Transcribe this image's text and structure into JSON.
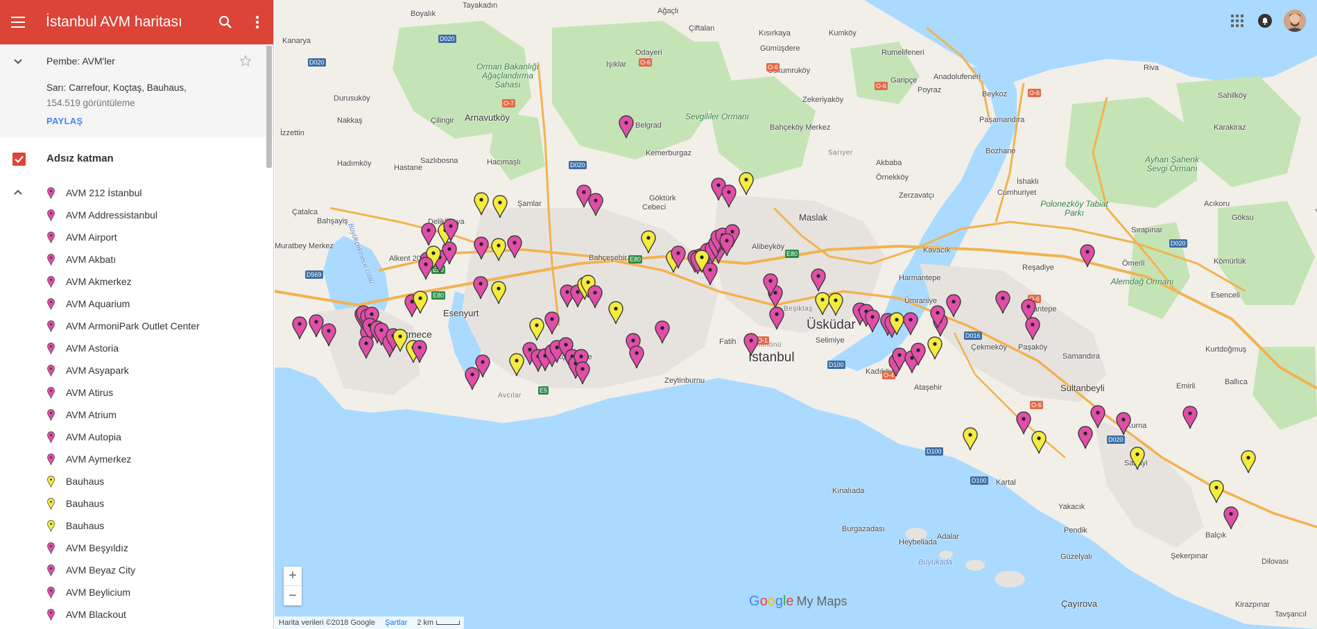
{
  "header": {
    "title": "İstanbul AVM haritası",
    "menu_icon": "menu-icon",
    "search_icon": "search-icon",
    "more_icon": "more-vert-icon",
    "color": "#db4437"
  },
  "info": {
    "layer_title": "Pembe: AVM'ler",
    "description": "Sarı: Carrefour, Koçtaş, Bauhaus,",
    "views": "154.519 görüntüleme",
    "share_label": "PAYLAŞ"
  },
  "layer": {
    "name": "Adsız katman",
    "checked": true
  },
  "features": [
    {
      "name": "AVM 212 İstanbul",
      "color": "pink"
    },
    {
      "name": "AVM Addressistanbul",
      "color": "pink"
    },
    {
      "name": "AVM Airport",
      "color": "pink"
    },
    {
      "name": "AVM Akbatı",
      "color": "pink"
    },
    {
      "name": "AVM Akmerkez",
      "color": "pink"
    },
    {
      "name": "AVM Aquarium",
      "color": "pink"
    },
    {
      "name": "AVM ArmoniPark Outlet Center",
      "color": "pink"
    },
    {
      "name": "AVM Astoria",
      "color": "pink"
    },
    {
      "name": "AVM Asyapark",
      "color": "pink"
    },
    {
      "name": "AVM Atirus",
      "color": "pink"
    },
    {
      "name": "AVM Atrium",
      "color": "pink"
    },
    {
      "name": "AVM Autopia",
      "color": "pink"
    },
    {
      "name": "AVM Aymerkez",
      "color": "pink"
    },
    {
      "name": "Bauhaus",
      "color": "yellow"
    },
    {
      "name": "Bauhaus",
      "color": "yellow"
    },
    {
      "name": "Bauhaus",
      "color": "yellow"
    },
    {
      "name": "AVM Beşyıldız",
      "color": "pink"
    },
    {
      "name": "AVM Beyaz City",
      "color": "pink"
    },
    {
      "name": "AVM Beylicium",
      "color": "pink"
    },
    {
      "name": "AVM Blackout",
      "color": "pink"
    }
  ],
  "colors": {
    "pink": "#e04ea8",
    "yellow": "#f4eb3f",
    "water": "#aadaff",
    "land": "#f2efe9",
    "park": "#c5e4b6",
    "urban": "#e6e3df"
  },
  "map": {
    "places": [
      {
        "name": "İstanbul",
        "class": "big"
      },
      {
        "name": "Üsküdar",
        "class": "big"
      },
      {
        "name": "Büyükçekmece",
        "class": "big-sm"
      },
      {
        "name": "Esenyurt",
        "class": "mid"
      },
      {
        "name": "Arnavutköy",
        "class": "mid"
      },
      {
        "name": "Maslak",
        "class": "mid"
      },
      {
        "name": "Kadıköy",
        "class": ""
      },
      {
        "name": "Ataşehir",
        "class": ""
      },
      {
        "name": "Sultanbeyli",
        "class": "mid"
      },
      {
        "name": "Samandıra",
        "class": ""
      },
      {
        "name": "Pendik",
        "class": ""
      },
      {
        "name": "Kartal",
        "class": ""
      },
      {
        "name": "Ümraniye",
        "class": ""
      },
      {
        "name": "Beykoz",
        "class": ""
      },
      {
        "name": "Zeytinburnu",
        "class": ""
      },
      {
        "name": "Fatih",
        "class": ""
      },
      {
        "name": "Küçükçekmece",
        "class": ""
      },
      {
        "name": "Avcılar",
        "class": "district"
      },
      {
        "name": "Bahçeşehir",
        "class": ""
      },
      {
        "name": "Sarıyer",
        "class": "district"
      },
      {
        "name": "Beşiktaş",
        "class": "district"
      },
      {
        "name": "Eminönü",
        "class": "district"
      },
      {
        "name": "Alibeyköy",
        "class": ""
      },
      {
        "name": "Çekmeköy",
        "class": ""
      },
      {
        "name": "Ömerli",
        "class": ""
      },
      {
        "name": "Kurna",
        "class": ""
      },
      {
        "name": "Sanayi",
        "class": ""
      },
      {
        "name": "Güzelyalı",
        "class": ""
      },
      {
        "name": "Çayırova",
        "class": "mid"
      },
      {
        "name": "Kınalıada",
        "class": ""
      },
      {
        "name": "Burgazadası",
        "class": ""
      },
      {
        "name": "Büyükada",
        "class": "water"
      },
      {
        "name": "Heybeliada",
        "class": ""
      },
      {
        "name": "Yakacık",
        "class": ""
      },
      {
        "name": "Kemerburgaz",
        "class": ""
      },
      {
        "name": "Göktürk",
        "class": ""
      },
      {
        "name": "Çatalca",
        "class": ""
      },
      {
        "name": "Hadımköy",
        "class": ""
      },
      {
        "name": "Hastane",
        "class": ""
      },
      {
        "name": "Sazlıbosna",
        "class": ""
      },
      {
        "name": "Deliklikaya",
        "class": ""
      },
      {
        "name": "Alkent 2000",
        "class": ""
      },
      {
        "name": "Bahşayiş",
        "class": ""
      },
      {
        "name": "Muratbey Merkez",
        "class": ""
      },
      {
        "name": "Boyalık",
        "class": ""
      },
      {
        "name": "Tayakadın",
        "class": ""
      },
      {
        "name": "Ağaçlı",
        "class": ""
      },
      {
        "name": "Çiftalan",
        "class": ""
      },
      {
        "name": "Kısırkaya",
        "class": ""
      },
      {
        "name": "Kumköy",
        "class": ""
      },
      {
        "name": "Rumelifeneri",
        "class": ""
      },
      {
        "name": "Gümüşdere",
        "class": ""
      },
      {
        "name": "Uskumruköy",
        "class": ""
      },
      {
        "name": "Zekeriyaköy",
        "class": ""
      },
      {
        "name": "Garipçe",
        "class": ""
      },
      {
        "name": "Poyraz",
        "class": ""
      },
      {
        "name": "Anadolufeneri",
        "class": ""
      },
      {
        "name": "Paşamandıra",
        "class": ""
      },
      {
        "name": "Riva",
        "class": ""
      },
      {
        "name": "Sahilköy",
        "class": ""
      },
      {
        "name": "Karakiraz",
        "class": ""
      },
      {
        "name": "Bozhane",
        "class": ""
      },
      {
        "name": "Akbaba",
        "class": ""
      },
      {
        "name": "Örnekköy",
        "class": ""
      },
      {
        "name": "Zerzavatçı",
        "class": ""
      },
      {
        "name": "Cumhuriyet",
        "class": ""
      },
      {
        "name": "İshaklı",
        "class": ""
      },
      {
        "name": "Acıkoru",
        "class": ""
      },
      {
        "name": "Göksu",
        "class": ""
      },
      {
        "name": "Yeniköy",
        "class": ""
      },
      {
        "name": "Sırapınar",
        "class": ""
      },
      {
        "name": "Reşadiye",
        "class": ""
      },
      {
        "name": "Kömürlük",
        "class": ""
      },
      {
        "name": "Nişantepe",
        "class": ""
      },
      {
        "name": "Esenceli",
        "class": ""
      },
      {
        "name": "Kurtdoğmuş",
        "class": ""
      },
      {
        "name": "Paşaköy",
        "class": ""
      },
      {
        "name": "Ballıca",
        "class": ""
      },
      {
        "name": "Emirli",
        "class": ""
      },
      {
        "name": "Balçık",
        "class": ""
      },
      {
        "name": "Şekerpınar",
        "class": ""
      },
      {
        "name": "Kirazpınar",
        "class": ""
      },
      {
        "name": "Dilovası",
        "class": ""
      },
      {
        "name": "Tavşancıl",
        "class": ""
      },
      {
        "name": "Cebeci",
        "class": ""
      },
      {
        "name": "Şamlar",
        "class": ""
      },
      {
        "name": "Durusuköy",
        "class": ""
      },
      {
        "name": "Nakkaş",
        "class": ""
      },
      {
        "name": "İzzettin",
        "class": ""
      },
      {
        "name": "Çilingir",
        "class": ""
      },
      {
        "name": "Hacımaşlı",
        "class": ""
      },
      {
        "name": "Işıklar",
        "class": ""
      },
      {
        "name": "Odayeri",
        "class": ""
      },
      {
        "name": "Bahçeköy Merkez",
        "class": ""
      },
      {
        "name": "Kanarya",
        "class": ""
      },
      {
        "name": "Belgrad",
        "class": ""
      },
      {
        "name": "Adalar",
        "class": ""
      },
      {
        "name": "Kavacık",
        "class": ""
      },
      {
        "name": "Harmantepe",
        "class": ""
      },
      {
        "name": "Selimiye",
        "class": ""
      },
      {
        "name": "Orman Bakanlığı Ağaçlandırma Sahası",
        "class": "green"
      },
      {
        "name": "Sevgililer Ormanı",
        "class": "green"
      },
      {
        "name": "Polonezköy Tabiat Parkı",
        "class": "green"
      },
      {
        "name": "Ayhan Şahenk Sevgi Ormanı",
        "class": "green"
      },
      {
        "name": "Alemdağ Ormanı",
        "class": "green"
      },
      {
        "name": "Büyükçekmece Gölü",
        "class": "water"
      }
    ],
    "attribution": "Harita verileri ©2018 Google",
    "terms": "Şartlar",
    "scale": "2 km",
    "logo_brand": "Google",
    "logo_product": "My Maps",
    "zoom_in": "+",
    "zoom_out": "−"
  }
}
